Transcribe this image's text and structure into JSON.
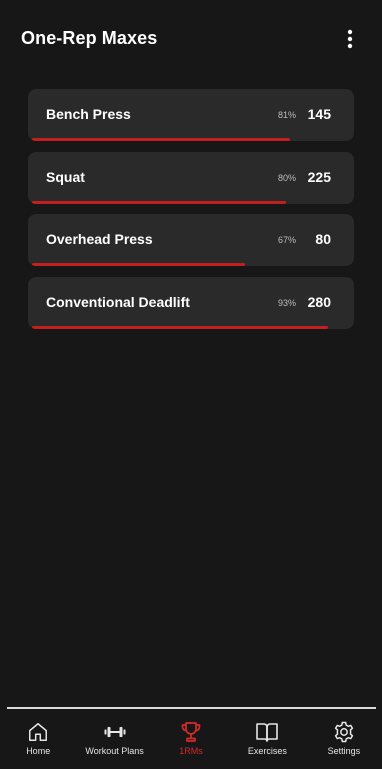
{
  "header": {
    "title": "One-Rep Maxes",
    "menu_icon": "more-vertical-icon"
  },
  "lifts": [
    {
      "name": "Bench Press",
      "percent": "81%",
      "value": "145",
      "progress": 0.81
    },
    {
      "name": "Squat",
      "percent": "80%",
      "value": "225",
      "progress": 0.8
    },
    {
      "name": "Overhead Press",
      "percent": "67%",
      "value": "80",
      "progress": 0.67
    },
    {
      "name": "Conventional Deadlift",
      "percent": "93%",
      "value": "280",
      "progress": 0.93
    }
  ],
  "nav": {
    "items": [
      {
        "label": "Home",
        "icon": "home-icon",
        "active": false
      },
      {
        "label": "Workout Plans",
        "icon": "dumbbell-icon",
        "active": false
      },
      {
        "label": "1RMs",
        "icon": "trophy-icon",
        "active": true
      },
      {
        "label": "Exercises",
        "icon": "book-icon",
        "active": false
      },
      {
        "label": "Settings",
        "icon": "gear-icon",
        "active": false
      }
    ]
  },
  "colors": {
    "background": "#171717",
    "card": "#2a2a2a",
    "accent": "#c41f1f",
    "active_nav": "#d42b2b"
  }
}
